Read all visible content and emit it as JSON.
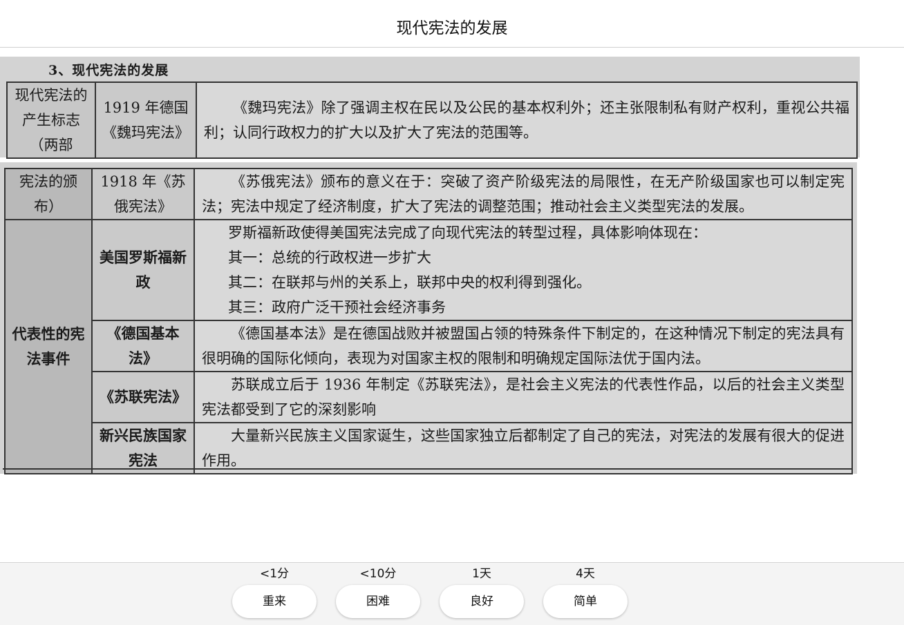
{
  "card_title": "现代宪法的发展",
  "section_heading": "3、现代宪法的发展",
  "table_top": {
    "rows": [
      {
        "col1": "现代宪法的产生标志（两部",
        "col2": "1919 年德国《魏玛宪法》",
        "col3": "《魏玛宪法》除了强调主权在民以及公民的基本权利外；还主张限制私有财产权利，重视公共福利；认同行政权力的扩大以及扩大了宪法的范围等。"
      }
    ]
  },
  "table_bottom": {
    "row_1": {
      "col1": "宪法的颁布）",
      "col2": "1918 年《苏俄宪法》",
      "col3": "《苏俄宪法》颁布的意义在于：突破了资产阶级宪法的局限性，在无产阶级国家也可以制定宪法；宪法中规定了经济制度，扩大了宪法的调整范围；推动社会主义类型宪法的发展。"
    },
    "group_label": "代表性的宪法事件",
    "row_2": {
      "col2": "美国罗斯福新政",
      "intro": "罗斯福新政使得美国宪法完成了向现代宪法的转型过程，具体影响体现在：",
      "points": [
        "其一：总统的行政权进一步扩大",
        "其二：在联邦与州的关系上，联邦中央的权利得到强化。",
        "其三：政府广泛干预社会经济事务"
      ]
    },
    "row_3": {
      "col2": "《德国基本法》",
      "col3": "《德国基本法》是在德国战败并被盟国占领的特殊条件下制定的，在这种情况下制定的宪法具有很明确的国际化倾向，表现为对国家主权的限制和明确规定国际法优于国内法。"
    },
    "row_4": {
      "col2": "《苏联宪法》",
      "col3": "苏联成立后于 1936 年制定《苏联宪法》，是社会主义宪法的代表性作品，以后的社会主义类型宪法都受到了它的深刻影响"
    },
    "row_5": {
      "col2": "新兴民族国家宪法",
      "col3": "大量新兴民族主义国家诞生，这些国家独立后都制定了自己的宪法，对宪法的发展有很大的促进作用。"
    }
  },
  "answer_buttons": [
    {
      "interval": "<1分",
      "label": "重来"
    },
    {
      "interval": "<10分",
      "label": "困难"
    },
    {
      "interval": "1天",
      "label": "良好"
    },
    {
      "interval": "4天",
      "label": "简单"
    }
  ]
}
